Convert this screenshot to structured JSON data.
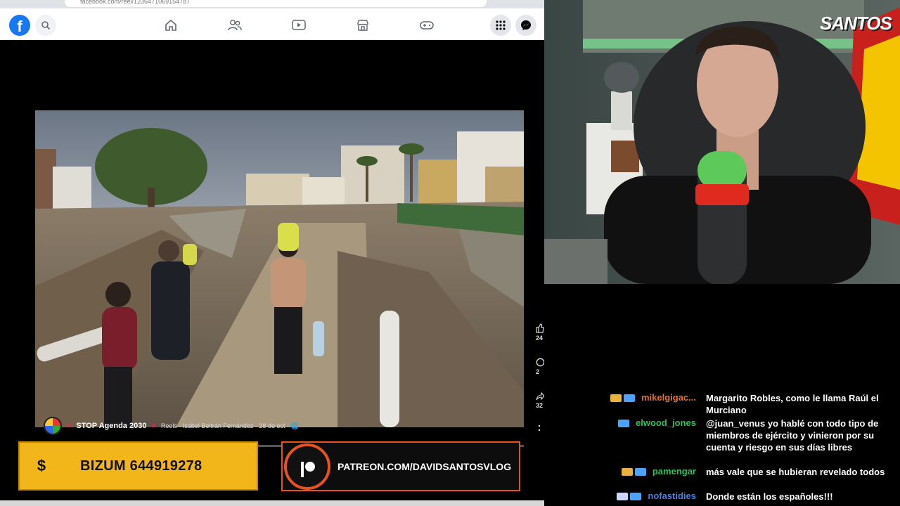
{
  "browser": {
    "url": "facebook.com/reel/1236471069154787"
  },
  "fb_nav": {
    "logo": "f",
    "icons": [
      "home-icon",
      "friends-icon",
      "video-icon",
      "marketplace-icon",
      "gaming-icon"
    ],
    "right": [
      "menu-grid-icon",
      "messenger-icon"
    ]
  },
  "reel": {
    "caption_prefix": "✕",
    "caption_title": "STOP Agenda 2030",
    "caption_suffix": "✕",
    "caption_meta": "Reels · Isabel Beltrán Fernández · 28 de oct · 🌐",
    "progress": 0.16
  },
  "side_controls": {
    "likes": "24",
    "comments": "2",
    "shares": "32"
  },
  "banners": {
    "bizum_sign": "$",
    "bizum": "BIZUM 644919278",
    "patreon": "PATREON.COM/DAVIDSANTOSVLOG"
  },
  "overlay": {
    "logo_text": "SANTOS"
  },
  "colors": {
    "facebook": "#1877f2",
    "bizum": "#f2b61a",
    "patreon": "#e8521e",
    "mic_green": "#5cc95a"
  },
  "chat": [
    {
      "user": "mikelgigac...",
      "color": "#e0742f",
      "text": "Margarito Robles, como le llama Raúl el Murciano",
      "badges": [
        "chat-badge-icon",
        "verified-badge-icon"
      ]
    },
    {
      "user": "elwood_jones",
      "color": "#2fbf5f",
      "text": "@juan_venus yo hablé con todo tipo de miembros de ejército y vinieron por su cuenta y riesgo en sus días libres",
      "badges": [
        "verified-badge-icon"
      ]
    },
    {
      "user": "pamengar",
      "color": "#2fbf5f",
      "text": "más vale que se hubieran revelado todos",
      "badges": [
        "chat-badge-icon",
        "verified-badge-icon"
      ]
    },
    {
      "user": "nofastidies",
      "color": "#4a7fe0",
      "text": "Donde están los españoles!!!",
      "badges": [
        "diamond-badge-icon",
        "verified-badge-icon"
      ]
    }
  ]
}
